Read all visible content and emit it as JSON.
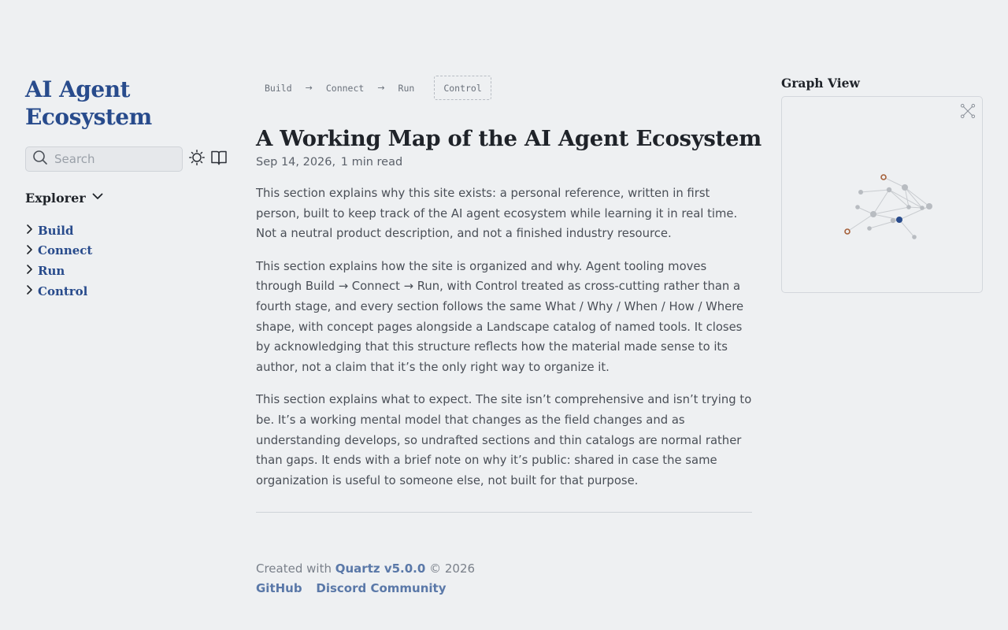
{
  "site": {
    "title_line1": "AI Agent",
    "title_line2": "Ecosystem"
  },
  "search": {
    "placeholder": "Search"
  },
  "explorer": {
    "title": "Explorer",
    "items": [
      {
        "label": "Build"
      },
      {
        "label": "Connect"
      },
      {
        "label": "Run"
      },
      {
        "label": "Control"
      }
    ]
  },
  "breadcrumbs": {
    "items": [
      "Build",
      "Connect",
      "Run"
    ],
    "current": "Control",
    "separator": "→"
  },
  "article": {
    "title": "A Working Map of the AI Agent Ecosystem",
    "date": "Sep 14, 2026,",
    "reading_time": "1 min read",
    "paragraphs": [
      "This section explains why this site exists: a personal reference, written in first person, built to keep track of the AI agent ecosystem while learning it in real time. Not a neutral product description, and not a finished industry resource.",
      "This section explains how the site is organized and why. Agent tooling moves through Build → Connect → Run, with Control treated as cross-cutting rather than a fourth stage, and every section follows the same What / Why / When / How / Where shape, with concept pages alongside a Landscape catalog of named tools. It closes by acknowledging that this structure reflects how the material made sense to its author, not a claim that it’s the only right way to organize it.",
      "This section explains what to expect. The site isn’t comprehensive and isn’t trying to be. It’s a working mental model that changes as the field changes and as understanding develops, so undrafted sections and thin catalogs are normal rather than gaps. It ends with a brief note on why it’s public: shared in case the same organization is useful to someone else, not built for that purpose."
    ]
  },
  "footer": {
    "created_with": "Created with",
    "quartz_link": "Quartz v5.0.0",
    "copyright": "© 2026",
    "links": [
      "GitHub",
      "Discord Community"
    ]
  },
  "graph": {
    "title": "Graph View",
    "colors": {
      "node": "#b8bcc1",
      "edge": "#c9ccd0",
      "current": "#284b8c",
      "visited": "#a5603a"
    }
  },
  "icons": {
    "search": "search-icon",
    "theme": "sun-icon",
    "reader": "book-icon",
    "chevron": "chevron-right-icon",
    "expand": "expand-graph-icon"
  }
}
